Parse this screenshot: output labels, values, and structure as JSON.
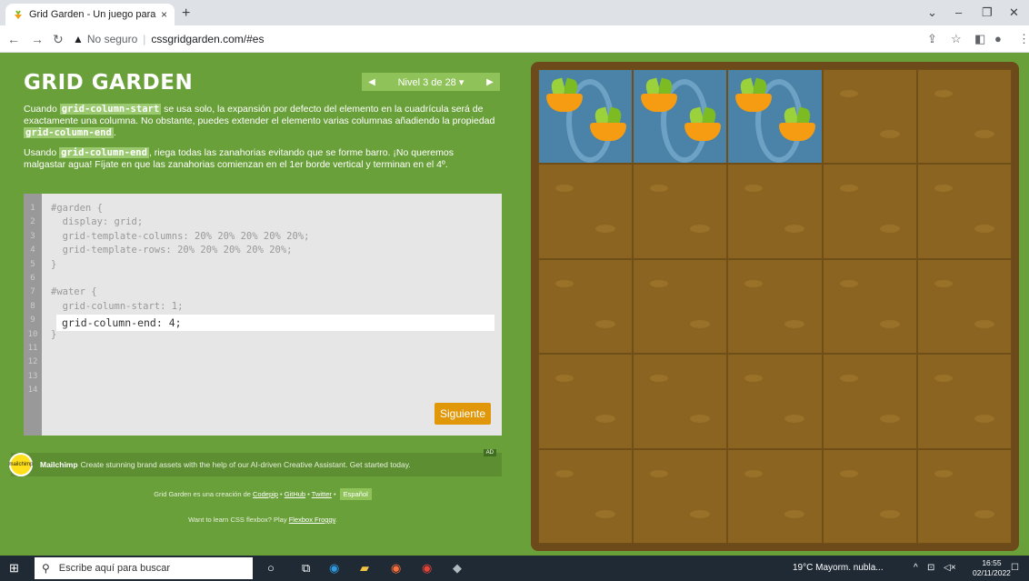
{
  "browser": {
    "tab_title": "Grid Garden - Un juego para apr...",
    "tab_close": "×",
    "new_tab": "+",
    "address_insecure": "No seguro",
    "address_url": "cssgridgarden.com/#es"
  },
  "game": {
    "logo": "GRID GARDEN",
    "level_prev": "◀",
    "level_label": "Nivel 3 de 28 ▾",
    "level_next": "▶",
    "instr_p1_a": "Cuando ",
    "instr_p1_code1": "grid-column-start",
    "instr_p1_b": " se usa solo, la expansión por defecto del elemento en la cuadrícula será de exactamente una columna. No obstante, puedes extender el elemento varias columnas añadiendo la propiedad ",
    "instr_p1_code2": "grid-column-end",
    "instr_p1_c": ".",
    "instr_p2_a": "Usando ",
    "instr_p2_code": "grid-column-end",
    "instr_p2_b": ", riega todas las zanahorias evitando que se forme barro. ¡No queremos malgastar agua! Fíjate en que las zanahorias comienzan en el 1er borde vertical y terminan en el 4º.",
    "line_numbers": [
      "1",
      "2",
      "3",
      "4",
      "5",
      "6",
      "7",
      "8",
      "9",
      "10",
      "11",
      "12",
      "13",
      "14"
    ],
    "code_lines": [
      "#garden {",
      "  display: grid;",
      "  grid-template-columns: 20% 20% 20% 20% 20%;",
      "  grid-template-rows: 20% 20% 20% 20% 20%;",
      "}",
      "",
      "#water {",
      "  grid-column-start: 1;",
      "",
      "}"
    ],
    "input_value": "grid-column-end: 4;",
    "next_button": "Siguiente"
  },
  "ad": {
    "brand": "Mailchimp",
    "text": "Create stunning brand assets with the help of our AI-driven Creative Assistant. Get started today.",
    "badge": "AD",
    "icon_text": "mailchimp"
  },
  "footer": {
    "credit_a": "Grid Garden es una creación de ",
    "codepip": "Codepip",
    "github": "GitHub",
    "twitter": "Twitter",
    "lang": "Español",
    "sep": " • ",
    "flexbox_a": "Want to learn CSS flexbox? Play ",
    "flexbox_link": "Flexbox Froggy",
    "flexbox_b": "."
  },
  "taskbar": {
    "search_placeholder": "Escribe aquí para buscar",
    "weather": "19°C  Mayorm. nubla...",
    "time": "16:55",
    "date": "02/11/2022"
  }
}
